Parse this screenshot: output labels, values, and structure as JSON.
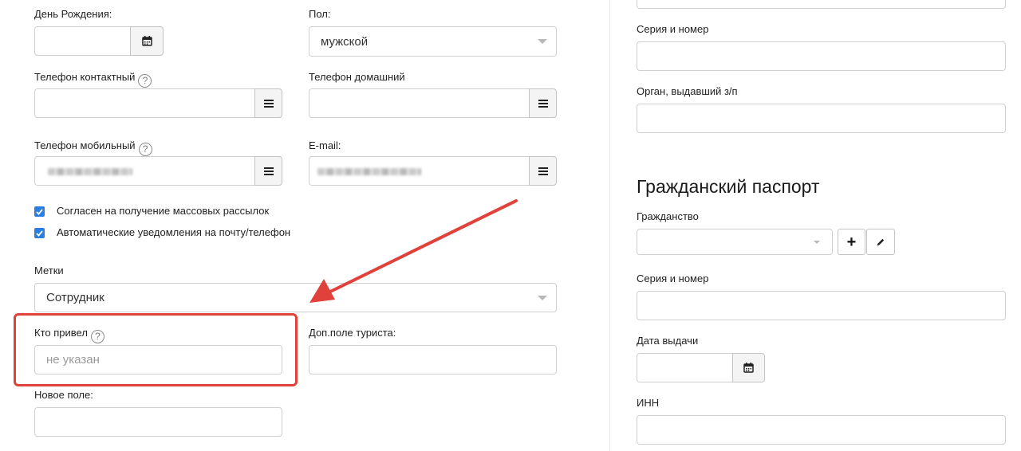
{
  "left": {
    "birthday_label": "День Рождения:",
    "gender_label": "Пол:",
    "gender_value": "мужской",
    "phone_contact_label": "Телефон контактный",
    "phone_home_label": "Телефон домашний",
    "phone_mobile_label": "Телефон мобильный",
    "email_label": "E-mail:",
    "consent_mailing_label": "Согласен на получение массовых рассылок",
    "auto_notify_label": "Автоматические уведомления на почту/телефон",
    "tags_label": "Метки",
    "tags_value": "Сотрудник",
    "referrer_label": "Кто привел",
    "referrer_placeholder": "не указан",
    "extra_field_label": "Доп.поле туриста:",
    "new_field_label": "Новое поле:",
    "help_glyph": "?"
  },
  "right": {
    "serial_number_label_1": "Серия и номер",
    "issuer_label": "Орган, выдавший з/п",
    "civil_passport_title": "Гражданский паспорт",
    "citizenship_label": "Гражданство",
    "add_glyph": "+",
    "serial_number_label_2": "Серия и номер",
    "issue_date_label": "Дата выдачи",
    "inn_label": "ИНН"
  },
  "colors": {
    "annotation_red": "#e0413a",
    "checkbox_blue": "#2a7de1"
  },
  "icons": {
    "calendar": "calendar-icon",
    "menu": "menu-icon",
    "help": "help-icon",
    "plus": "plus-icon",
    "pencil": "pencil-icon",
    "dropdown": "chevron-down-icon"
  }
}
